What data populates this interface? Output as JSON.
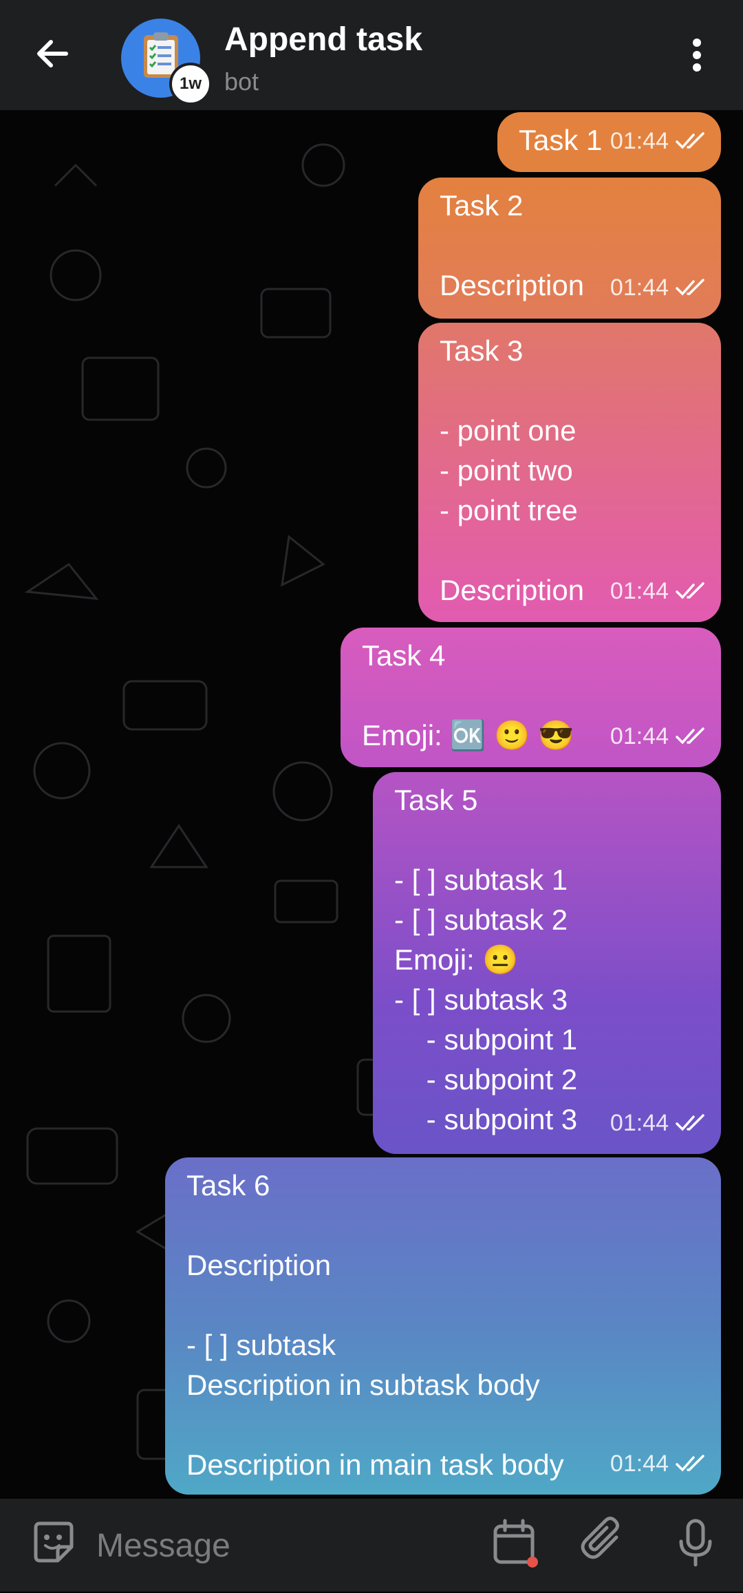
{
  "header": {
    "back_icon": "arrow-left-icon",
    "title": "Append task",
    "subtitle": "bot",
    "avatar_badge": "1w",
    "avatar_icon": "clipboard-checklist-icon",
    "menu_icon": "more-vertical-icon"
  },
  "messages": [
    {
      "text": "Task 1",
      "time": "01:44"
    },
    {
      "text": "Task 2\n\nDescription",
      "time": "01:44"
    },
    {
      "text": "Task 3\n\n- point one\n- point two\n- point tree\n\nDescription",
      "time": "01:44"
    },
    {
      "text": "Task 4\n\nEmoji: 🆗 🙂 😎",
      "time": "01:44"
    },
    {
      "text": "Task 5\n\n- [ ] subtask 1\n- [ ] subtask 2\nEmoji: 😐\n- [ ] subtask 3\n    - subpoint 1\n    - subpoint 2\n    - subpoint 3",
      "time": "01:44"
    },
    {
      "text": "Task 6\n\nDescription\n\n- [ ] subtask\nDescription in subtask body\n\nDescription in main task body",
      "time": "01:44"
    }
  ],
  "composer": {
    "placeholder": "Message",
    "emoji_icon": "sticker-smile-icon",
    "schedule_icon": "calendar-icon",
    "attach_icon": "paperclip-icon",
    "mic_icon": "microphone-icon"
  },
  "colors": {
    "header_bg": "#1e1f21",
    "bubble_top": "#e3823e",
    "bubble_mid": "#e25bb1",
    "bubble_purple": "#6d4fc8",
    "bubble_bottom": "#4fa6c7",
    "accent": "#4b86ff"
  }
}
